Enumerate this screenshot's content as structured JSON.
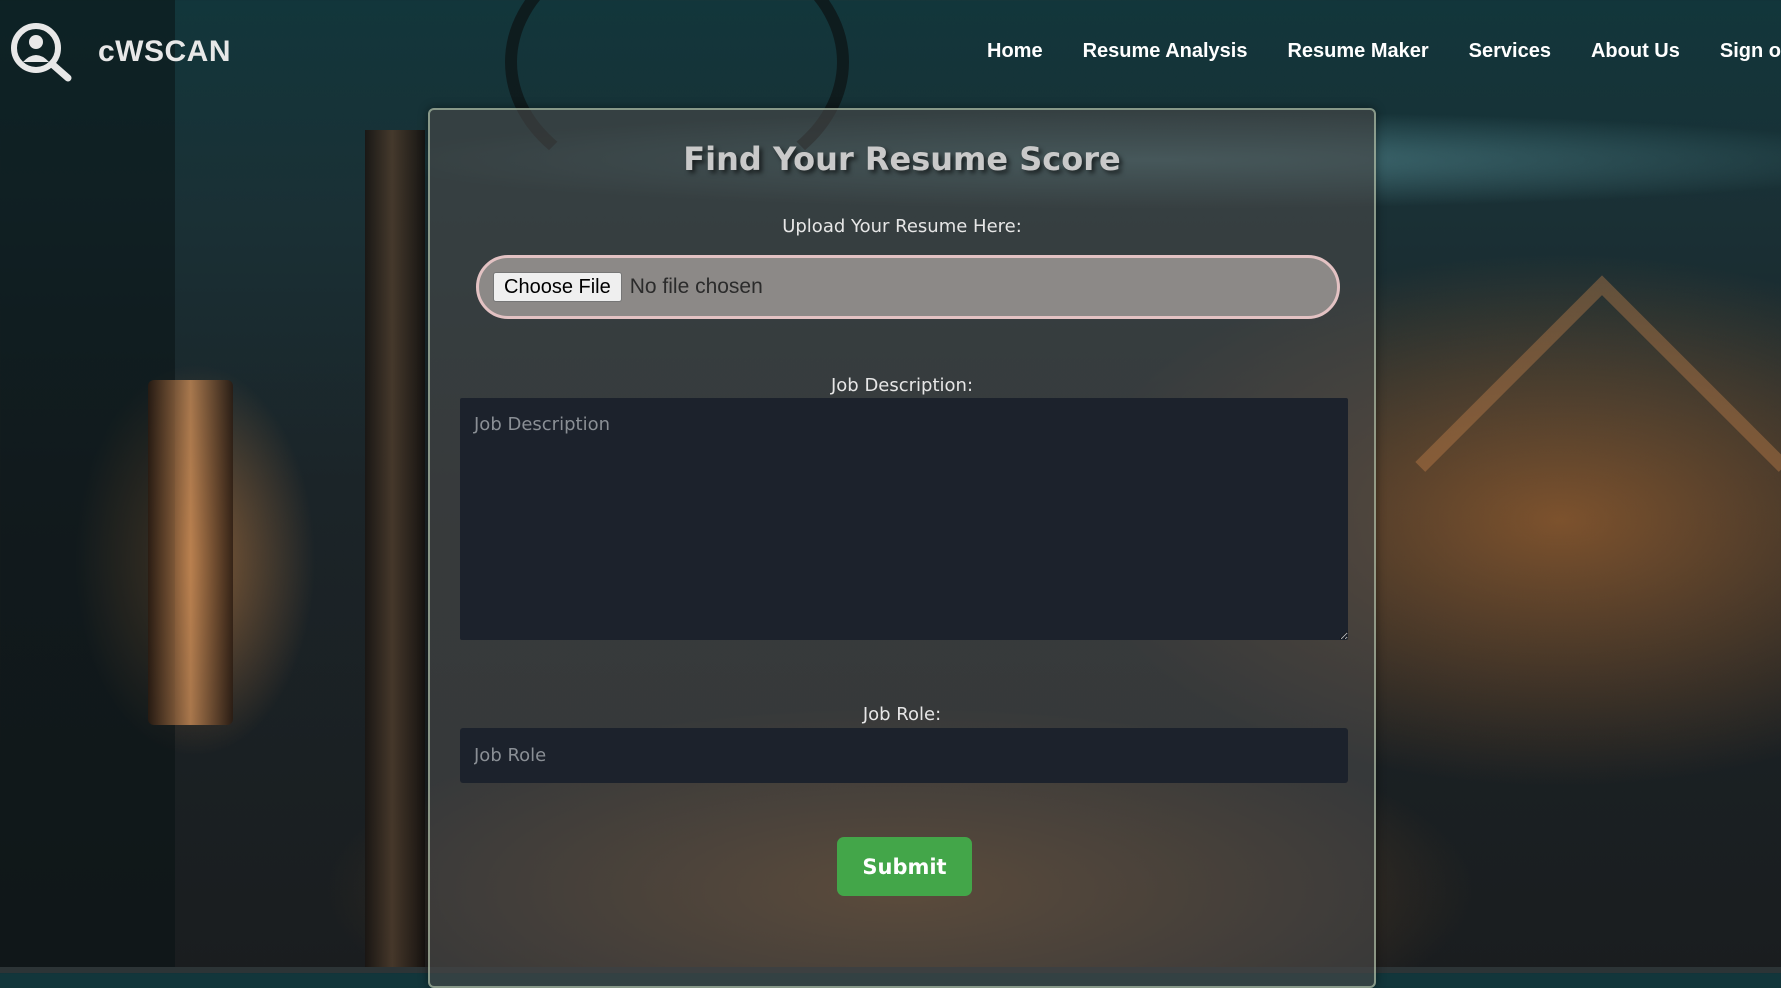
{
  "brand": {
    "name": "cWSCAN",
    "logo_icon": "magnifier-person-icon"
  },
  "nav": {
    "items": [
      {
        "label": "Home"
      },
      {
        "label": "Resume Analysis"
      },
      {
        "label": "Resume Maker"
      },
      {
        "label": "Services"
      },
      {
        "label": "About Us"
      },
      {
        "label": "Sign ou"
      }
    ]
  },
  "form": {
    "title": "Find Your Resume Score",
    "upload_label": "Upload Your Resume Here:",
    "choose_file_label": "Choose File",
    "file_status": "No file chosen",
    "job_description_label": "Job Description:",
    "job_description_placeholder": "Job Description",
    "job_description_value": "",
    "job_role_label": "Job Role:",
    "job_role_placeholder": "Job Role",
    "job_role_value": "",
    "submit_label": "Submit"
  },
  "colors": {
    "submit": "#43a649",
    "upload_border": "#e3c2c3",
    "input_bg": "#1c222c"
  }
}
